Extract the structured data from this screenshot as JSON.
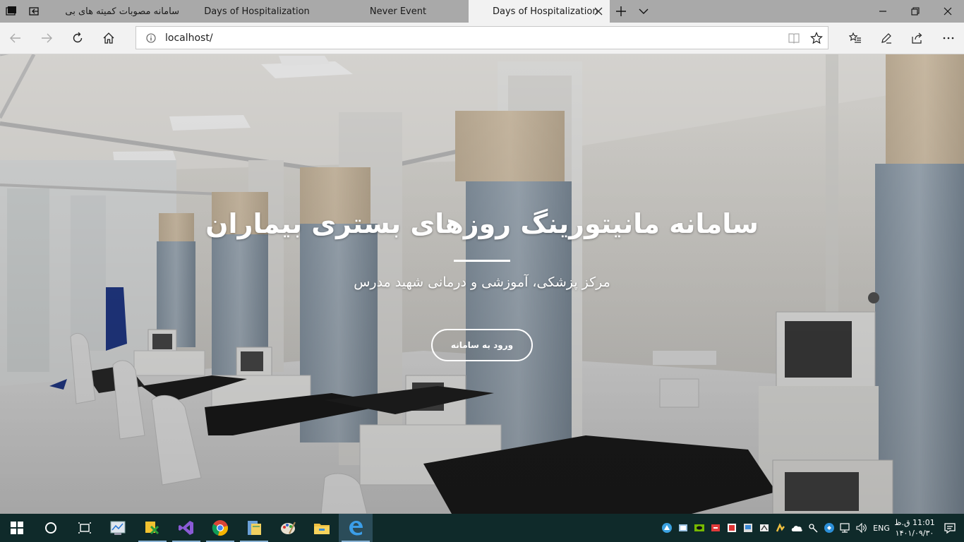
{
  "browser": {
    "tabs": [
      {
        "title": "سامانه مصوبات کمیته های بی",
        "active": false,
        "rtl": true
      },
      {
        "title": "Days of Hospitalization",
        "active": false,
        "rtl": false
      },
      {
        "title": "Never Event",
        "active": false,
        "rtl": false
      },
      {
        "title": "Days of Hospitalization",
        "active": true,
        "rtl": false
      }
    ],
    "address": {
      "url": "localhost/"
    }
  },
  "hero": {
    "title": "سامانه مانیتورینگ روزهای بستری بیماران",
    "subtitle": "مرکز پزشکی، آموزشی و درمانی شهید مدرس",
    "login_button": "ورود به سامانه"
  },
  "taskbar": {
    "apps": [
      "start",
      "cortana",
      "task-view",
      "task-manager",
      "network-tool",
      "visual-studio",
      "chrome",
      "file-cabinet",
      "paint",
      "file-explorer",
      "edge"
    ],
    "language": "ENG",
    "clock": {
      "time": "11:01 ق.ظ",
      "date": "۱۴۰۱/۰۹/۳۰"
    }
  },
  "colors": {
    "tabbar": "#a9a9a9",
    "taskbar": "#0f2a2a",
    "edge_blue": "#0078d7"
  }
}
